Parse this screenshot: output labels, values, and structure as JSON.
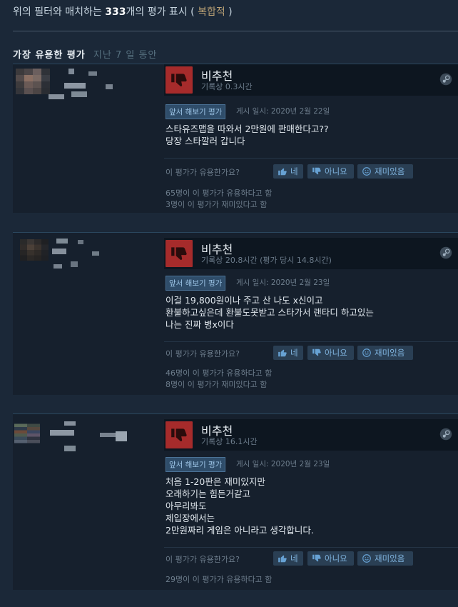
{
  "header": {
    "filter_prefix": "위의 필터와 매치하는",
    "count": "333",
    "filter_suffix": "개의 평가 표시",
    "paren_open": "(",
    "mixed_label": "복합적",
    "paren_close": ")"
  },
  "section": {
    "title": "가장 유용한 평가",
    "subtitle": "지난 7 일 동안"
  },
  "common": {
    "helpful_question": "이 평가가 유용한가요?",
    "yes_label": "네",
    "no_label": "아니요",
    "funny_label": "재미있음",
    "early_access_badge": "앞서 해보기 평가"
  },
  "colors": {
    "background": "#1b2838",
    "card": "#16202d",
    "negative": "#a62b2b",
    "mixed": "#b9a074",
    "button_text": "#7fb3de"
  },
  "reviews": [
    {
      "verdict": "비추천",
      "hours": "기록상 0.3시간",
      "posted": "게시 일시: 2020년 2월 22일",
      "content": [
        "스타유즈맵을 따와서 2만원에 판매한다고??",
        "당장 스타깔러 갑니다"
      ],
      "helpful_count": "65명이 이 평가가 유용하다고 함",
      "funny_count": "3명이 이 평가가 재미있다고 함"
    },
    {
      "verdict": "비추천",
      "hours": "기록상 20.8시간 (평가 당시 14.8시간)",
      "posted": "게시 일시: 2020년 2월 23일",
      "content": [
        "이걸 19,800원이나 주고 산 나도 x신이고",
        "환불하고싶은데 환불도못받고 스타가서 랜타디 하고있는",
        "나는 진짜 병x이다"
      ],
      "helpful_count": "46명이 이 평가가 유용하다고 함",
      "funny_count": "8명이 이 평가가 재미있다고 함"
    },
    {
      "verdict": "비추천",
      "hours": "기록상 16.1시간",
      "posted": "게시 일시: 2020년 2월 23일",
      "content": [
        "처음 1-20판은 재미있지만",
        "오래하기는 힘든거같고",
        "아무리봐도",
        "제입장에서는",
        "2만원짜리 게임은 아니라고 생각합니다."
      ],
      "helpful_count": "29명이 이 평가가 유용하다고 함",
      "funny_count": ""
    }
  ]
}
